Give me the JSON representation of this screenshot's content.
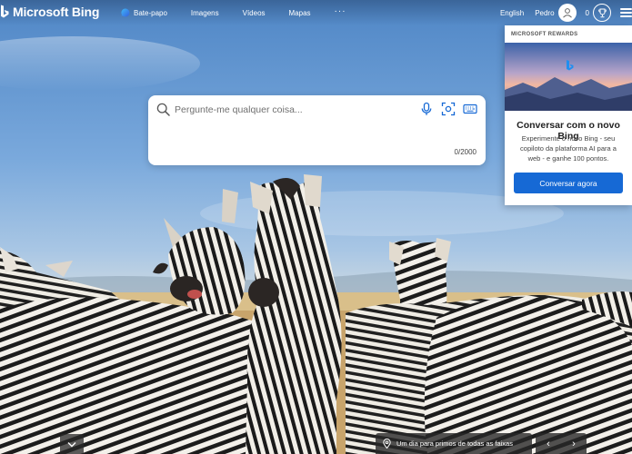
{
  "brand": {
    "name": "Microsoft Bing"
  },
  "nav": {
    "items": [
      {
        "label": "Bate-papo",
        "icon": "chat-icon"
      },
      {
        "label": "Imagens"
      },
      {
        "label": "Vídeos"
      },
      {
        "label": "Mapas"
      }
    ],
    "more_label": "···"
  },
  "account": {
    "language": "English",
    "user_name": "Pedro",
    "points": "0"
  },
  "search": {
    "placeholder": "Pergunte-me qualquer coisa...",
    "value": "",
    "char_count": "0/2000"
  },
  "rewards": {
    "title": "MICROSOFT REWARDS",
    "heading": "Conversar com o novo Bing",
    "description": "Experimente o novo Bing - seu copiloto da plataforma AI para a web - e ganhe 100 pontos.",
    "button_label": "Conversar agora"
  },
  "footer": {
    "caption": "Um dia para primos de todas as faixas"
  },
  "colors": {
    "accent": "#1669d5",
    "bing_logo": "#1f8ff0"
  }
}
